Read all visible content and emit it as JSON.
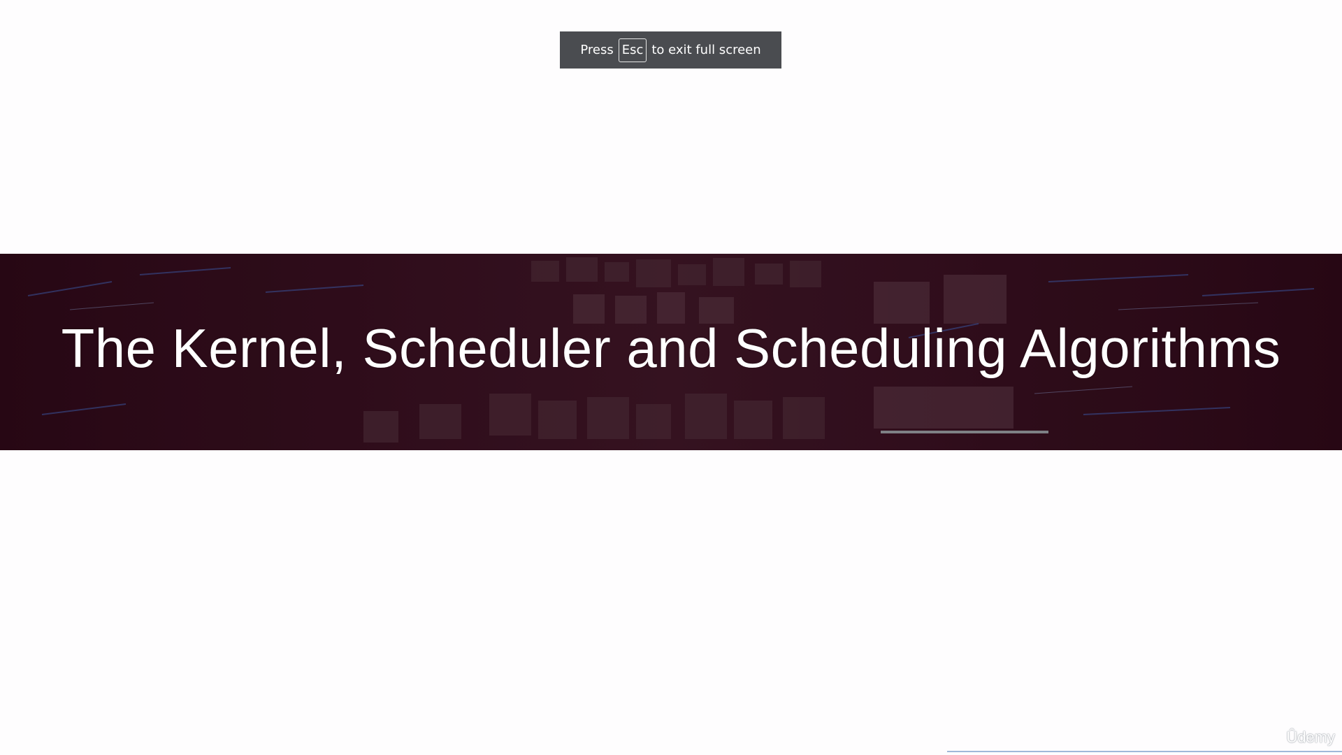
{
  "fullscreen_notice": {
    "prefix": "Press",
    "key": "Esc",
    "suffix": "to exit full screen"
  },
  "slide": {
    "title": "The Kernel, Scheduler and Scheduling Algorithms",
    "banner_color": "#2c0a18"
  },
  "watermark": {
    "text": "Ûdemy"
  }
}
